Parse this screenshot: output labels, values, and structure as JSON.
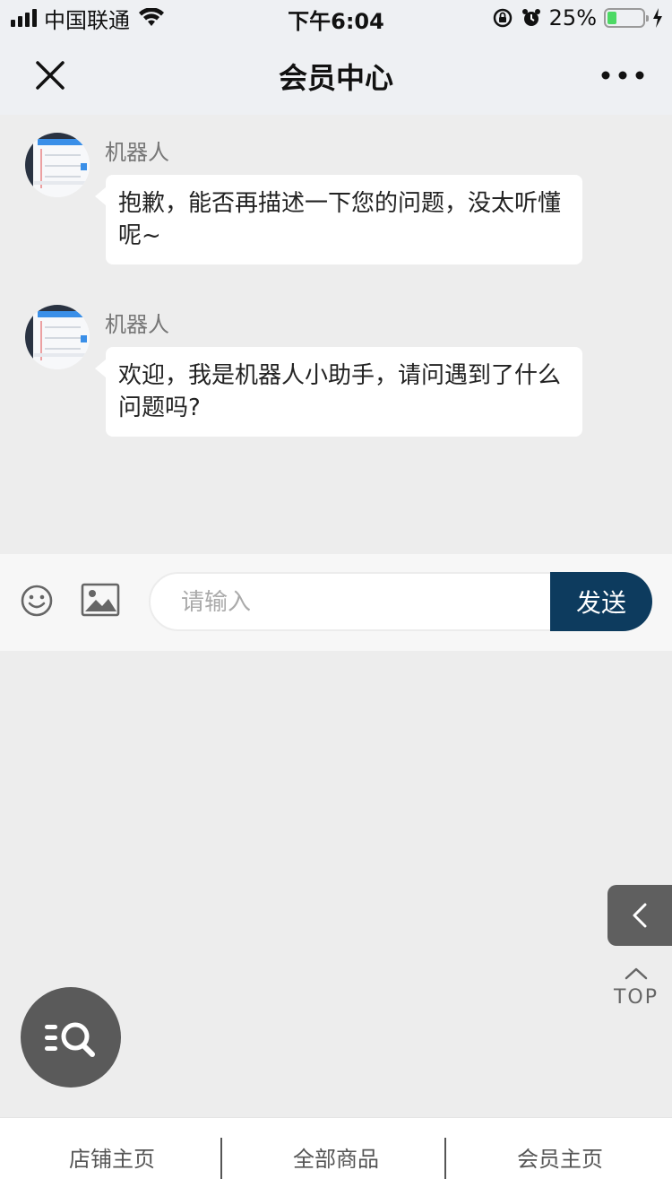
{
  "status_bar": {
    "carrier": "中国联通",
    "time": "下午6:04",
    "battery": "25%",
    "battery_level": 0.25,
    "icons": [
      "signal-icon",
      "wifi-icon",
      "orientation-lock-icon",
      "alarm-icon",
      "battery-icon",
      "charging-icon"
    ]
  },
  "header": {
    "title": "会员中心",
    "close_icon": "close-icon",
    "more_icon": "more-icon"
  },
  "messages": [
    {
      "sender": "机器人",
      "text": "抱歉，能否再描述一下您的问题，没太听懂呢~"
    },
    {
      "sender": "机器人",
      "text": "欢迎，我是机器人小助手，请问遇到了什么问题吗?"
    }
  ],
  "input_bar": {
    "placeholder": "请输入",
    "value": "",
    "send_label": "发送",
    "emoji_icon": "emoji-icon",
    "image_icon": "image-icon"
  },
  "floating": {
    "back_icon": "chevron-left-icon",
    "top_label": "TOP",
    "search_icon": "search-icon"
  },
  "tabs": [
    {
      "label": "店铺主页"
    },
    {
      "label": "全部商品"
    },
    {
      "label": "会员主页"
    }
  ],
  "colors": {
    "send_button": "#0d3b5e",
    "battery_fill": "#4cd964",
    "page_background": "#ededed"
  }
}
